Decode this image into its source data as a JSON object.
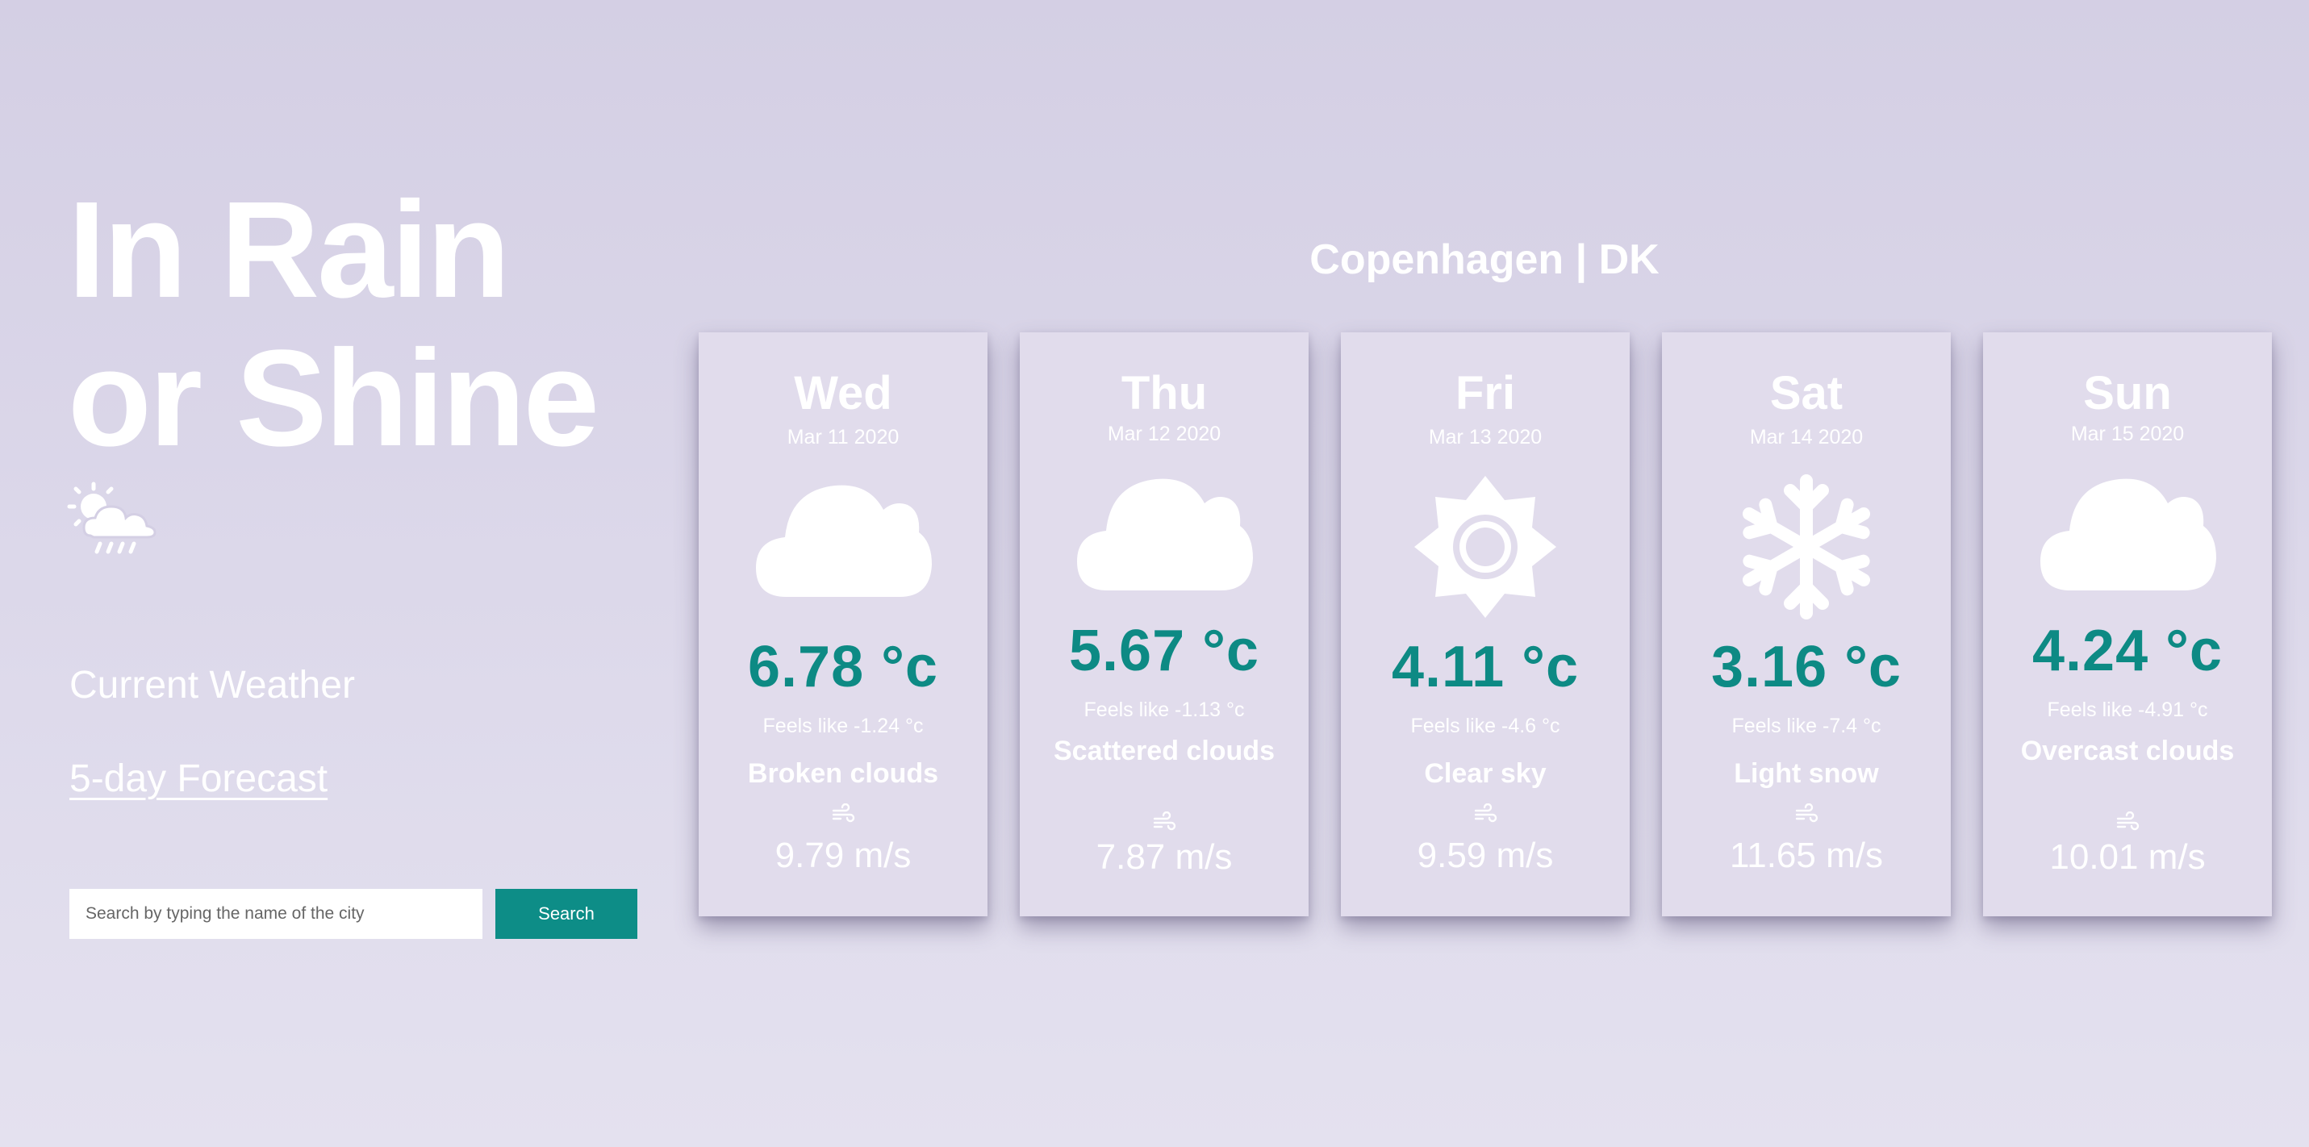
{
  "app": {
    "title": "In Rain or Shine",
    "title_icon": "sun-cloud-rain-icon"
  },
  "nav": {
    "current_label": "Current Weather",
    "forecast_label": "5-day Forecast"
  },
  "search": {
    "placeholder": "Search by typing the name of the city",
    "button_label": "Search"
  },
  "location": {
    "city_title": "Copenhagen | DK"
  },
  "colors": {
    "accent": "#0d8d87",
    "temperature": "#0d8a84",
    "card_background": "#e1dcec"
  },
  "forecast": [
    {
      "day": "Wed",
      "date": "Mar 11 2020",
      "icon": "cloud-icon",
      "temp": "6.78 °c",
      "feels_like": "Feels like -1.24 °c",
      "description": "Broken clouds",
      "wind_icon": "wind-icon",
      "wind": "9.79 m/s"
    },
    {
      "day": "Thu",
      "date": "Mar 12 2020",
      "icon": "cloud-icon",
      "temp": "5.67 °c",
      "feels_like": "Feels like -1.13 °c",
      "description": "Scattered clouds",
      "wind_icon": "wind-icon",
      "wind": "7.87 m/s"
    },
    {
      "day": "Fri",
      "date": "Mar 13 2020",
      "icon": "sun-icon",
      "temp": "4.11 °c",
      "feels_like": "Feels like -4.6 °c",
      "description": "Clear sky",
      "wind_icon": "wind-icon",
      "wind": "9.59 m/s"
    },
    {
      "day": "Sat",
      "date": "Mar 14 2020",
      "icon": "snowflake-icon",
      "temp": "3.16 °c",
      "feels_like": "Feels like -7.4 °c",
      "description": "Light snow",
      "wind_icon": "wind-icon",
      "wind": "11.65 m/s"
    },
    {
      "day": "Sun",
      "date": "Mar 15 2020",
      "icon": "cloud-icon",
      "temp": "4.24 °c",
      "feels_like": "Feels like -4.91 °c",
      "description": "Overcast clouds",
      "wind_icon": "wind-icon",
      "wind": "10.01 m/s"
    }
  ]
}
